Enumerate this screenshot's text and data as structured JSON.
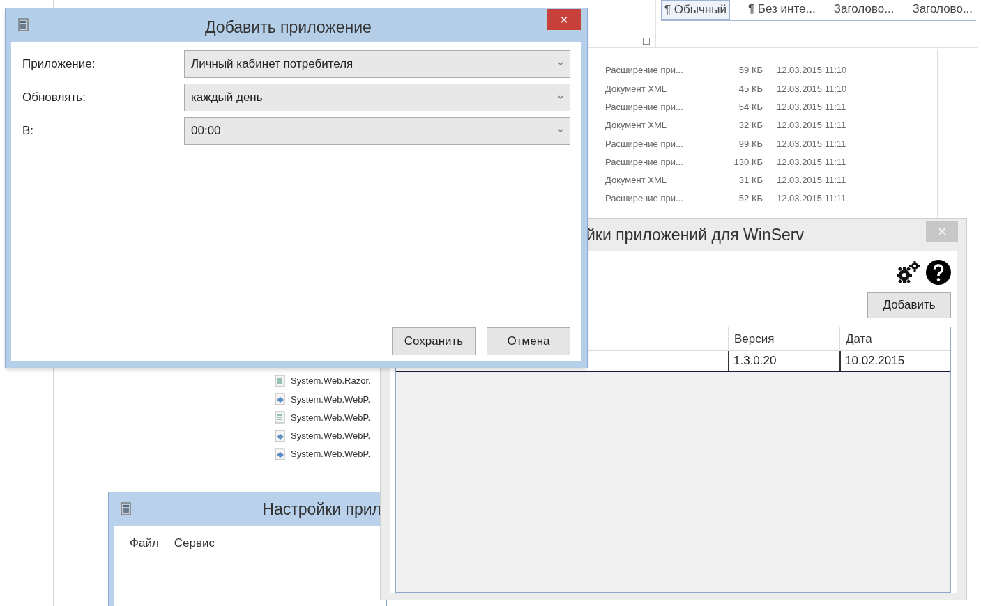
{
  "background_document": {
    "style_gallery": [
      "¶ Обычный",
      "¶ Без инте...",
      "Заголово...",
      "Заголово..."
    ],
    "file_rows": [
      {
        "type": "Расширение при...",
        "size": "59 КБ",
        "date": "12.03.2015 11:10"
      },
      {
        "type": "Документ XML",
        "size": "45 КБ",
        "date": "12.03.2015 11:10"
      },
      {
        "type": "Расширение при...",
        "size": "54 КБ",
        "date": "12.03.2015 11:11"
      },
      {
        "type": "Документ XML",
        "size": "32 КБ",
        "date": "12.03.2015 11:11"
      },
      {
        "type": "Расширение при...",
        "size": "99 КБ",
        "date": "12.03.2015 11:11"
      },
      {
        "type": "Расширение при...",
        "size": "130 КБ",
        "date": "12.03.2015 11:11"
      },
      {
        "type": "Документ XML",
        "size": "31 КБ",
        "date": "12.03.2015 11:11"
      },
      {
        "type": "Расширение при...",
        "size": "52 КБ",
        "date": "12.03.2015 11:11"
      }
    ],
    "file_names": [
      {
        "name": "System.Web.Razor.",
        "kind": "text"
      },
      {
        "name": "System.Web.WebP.",
        "kind": "assembly"
      },
      {
        "name": "System.Web.WebP.",
        "kind": "text"
      },
      {
        "name": "System.Web.WebP.",
        "kind": "assembly"
      },
      {
        "name": "System.Web.WebP.",
        "kind": "assembly"
      }
    ]
  },
  "back_window": {
    "title": "Настройки прил",
    "menu": [
      "Файл",
      "Сервис"
    ]
  },
  "settings_window": {
    "title": "йки приложений для WinServ",
    "close": "×",
    "add_button": "Добавить",
    "table": {
      "columns": [
        "",
        "Версия",
        "Дата"
      ],
      "rows": [
        {
          "cells": [
            "",
            "1.3.0.20",
            "10.02.2015"
          ]
        }
      ]
    }
  },
  "dialog": {
    "title": "Добавить приложение",
    "close": "×",
    "fields": [
      {
        "label": "Приложение:",
        "value": "Личный кабинет потребителя"
      },
      {
        "label": "Обновлять:",
        "value": "каждый день"
      },
      {
        "label": "В:",
        "value": "00:00"
      }
    ],
    "buttons": [
      "Сохранить",
      "Отмена"
    ]
  }
}
